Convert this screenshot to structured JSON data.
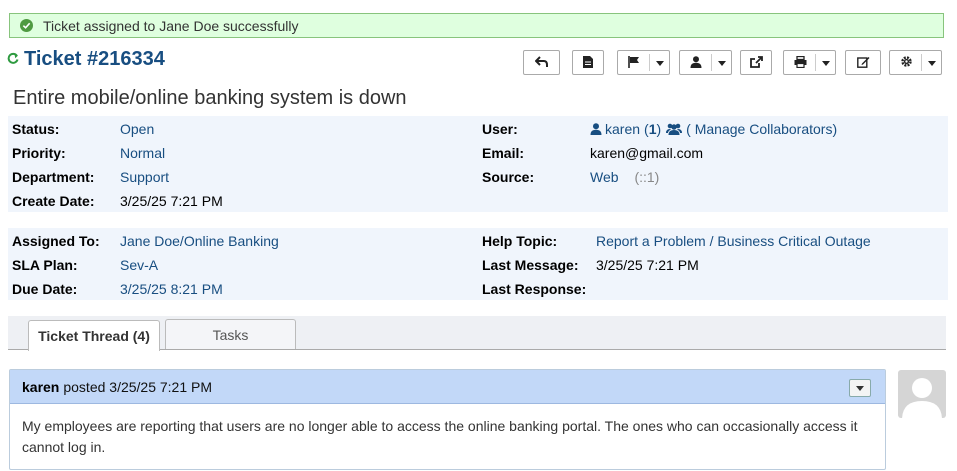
{
  "notice": {
    "text": "Ticket assigned to Jane Doe successfully"
  },
  "ticket": {
    "number": "Ticket #216334",
    "subject": "Entire mobile/online banking system is down"
  },
  "info_left": [
    {
      "label": "Status:",
      "value": "Open"
    },
    {
      "label": "Priority:",
      "value": "Normal"
    },
    {
      "label": "Department:",
      "value": "Support"
    },
    {
      "label": "Create Date:",
      "value": "3/25/25 7:21 PM"
    }
  ],
  "info_right": {
    "user_label": "User:",
    "user_name": "karen",
    "user_count_open": "(",
    "user_count": "1",
    "user_count_close": ")",
    "manage_collab": "( Manage Collaborators)",
    "email_label": "Email:",
    "email_value": "karen@gmail.com",
    "source_label": "Source:",
    "source_value": "Web",
    "source_ip": "(::1)"
  },
  "assign_left": [
    {
      "label": "Assigned To:",
      "value": "Jane Doe/Online Banking"
    },
    {
      "label": "SLA Plan:",
      "value": "Sev-A"
    },
    {
      "label": "Due Date:",
      "value": "3/25/25 8:21 PM"
    }
  ],
  "assign_right": [
    {
      "label": "Help Topic:",
      "value": "Report a Problem / Business Critical Outage"
    },
    {
      "label": "Last Message:",
      "value": "3/25/25 7:21 PM"
    },
    {
      "label": "Last Response:",
      "value": ""
    }
  ],
  "tabs": [
    {
      "label": "Ticket Thread (4)",
      "active": true
    },
    {
      "label": "Tasks",
      "active": false
    }
  ],
  "thread": {
    "author": "karen",
    "posted_text": "posted 3/25/25 7:21 PM",
    "body": "My employees are reporting that users are no longer able to access the online banking portal. The ones who can occasionally access it cannot log in."
  },
  "icons": {
    "toolbar": [
      "reply-icon",
      "note-icon",
      "flag-icon",
      "user-icon",
      "share-icon",
      "print-icon",
      "edit-icon",
      "gear-icon"
    ]
  },
  "colors": {
    "link": "#184e81",
    "success_bg": "#dfffdf",
    "thread_header": "#c2d8f8"
  }
}
